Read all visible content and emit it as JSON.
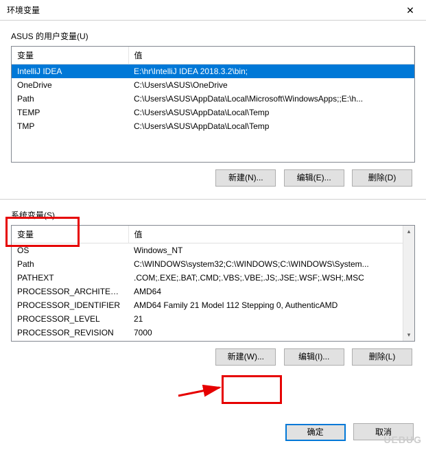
{
  "title": "环境变量",
  "user_section": {
    "label": "ASUS 的用户变量(U)",
    "columns": {
      "var": "变量",
      "val": "值"
    },
    "rows": [
      {
        "var": "IntelliJ IDEA",
        "val": "E:\\hr\\IntelliJ IDEA 2018.3.2\\bin;",
        "selected": true
      },
      {
        "var": "OneDrive",
        "val": "C:\\Users\\ASUS\\OneDrive"
      },
      {
        "var": "Path",
        "val": "C:\\Users\\ASUS\\AppData\\Local\\Microsoft\\WindowsApps;;E:\\h..."
      },
      {
        "var": "TEMP",
        "val": "C:\\Users\\ASUS\\AppData\\Local\\Temp"
      },
      {
        "var": "TMP",
        "val": "C:\\Users\\ASUS\\AppData\\Local\\Temp"
      }
    ],
    "buttons": {
      "new": "新建(N)...",
      "edit": "编辑(E)...",
      "delete": "删除(D)"
    }
  },
  "system_section": {
    "label": "系统变量(S)",
    "columns": {
      "var": "变量",
      "val": "值"
    },
    "rows": [
      {
        "var": "OS",
        "val": "Windows_NT"
      },
      {
        "var": "Path",
        "val": "C:\\WINDOWS\\system32;C:\\WINDOWS;C:\\WINDOWS\\System..."
      },
      {
        "var": "PATHEXT",
        "val": ".COM;.EXE;.BAT;.CMD;.VBS;.VBE;.JS;.JSE;.WSF;.WSH;.MSC"
      },
      {
        "var": "PROCESSOR_ARCHITECT...",
        "val": "AMD64"
      },
      {
        "var": "PROCESSOR_IDENTIFIER",
        "val": "AMD64 Family 21 Model 112 Stepping 0, AuthenticAMD"
      },
      {
        "var": "PROCESSOR_LEVEL",
        "val": "21"
      },
      {
        "var": "PROCESSOR_REVISION",
        "val": "7000"
      }
    ],
    "buttons": {
      "new": "新建(W)...",
      "edit": "编辑(I)...",
      "delete": "删除(L)"
    }
  },
  "dialog_buttons": {
    "ok": "确定",
    "cancel": "取消"
  },
  "watermark": "UEBUG"
}
